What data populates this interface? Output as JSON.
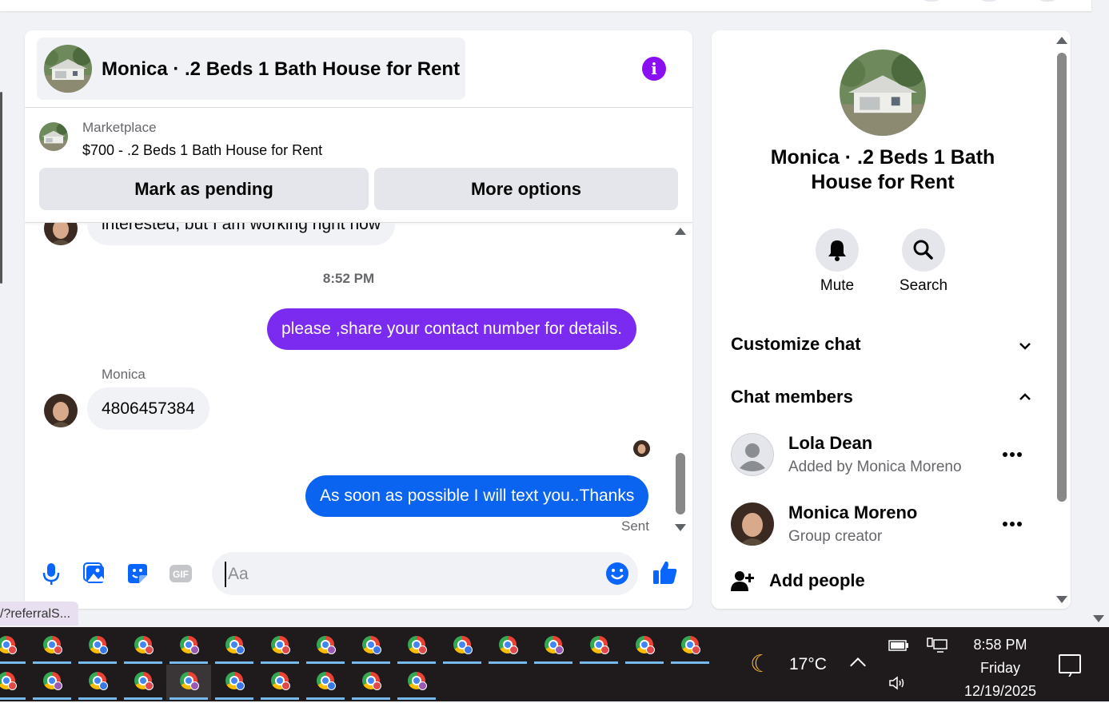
{
  "header": {
    "title": "Monica · .2 Beds 1 Bath House for Rent"
  },
  "marketplace": {
    "label": "Marketplace",
    "item": "$700 - .2 Beds 1 Bath House for Rent",
    "mark_pending_label": "Mark as pending",
    "more_options_label": "More options"
  },
  "messages": {
    "partial_text": "interested, but I am working right now",
    "timestamp": "8:52 PM",
    "outgoing_1": "please ,share your contact  number for details.",
    "sender_name": "Monica",
    "incoming_phone": "4806457384",
    "outgoing_2": "As soon as possible I will text you..Thanks",
    "status": "Sent"
  },
  "composer": {
    "placeholder": "Aa"
  },
  "side_panel": {
    "title": "Monica · .2 Beds 1 Bath House for Rent",
    "mute_label": "Mute",
    "search_label": "Search",
    "customize_label": "Customize chat",
    "members_label": "Chat members",
    "members": [
      {
        "name": "Lola Dean",
        "sub": "Added by Monica Moreno"
      },
      {
        "name": "Monica Moreno",
        "sub": "Group creator"
      }
    ],
    "add_people_label": "Add people"
  },
  "url_tip": "/?referralS...",
  "taskbar": {
    "temperature": "17°C",
    "time": "8:58 PM",
    "day": "Friday",
    "date": "12/19/2025"
  },
  "colors": {
    "accent_purple": "#7b2af0",
    "accent_blue": "#0a64f0",
    "messenger_blue": "#0866ff",
    "info_purple": "#8a0ff2"
  }
}
